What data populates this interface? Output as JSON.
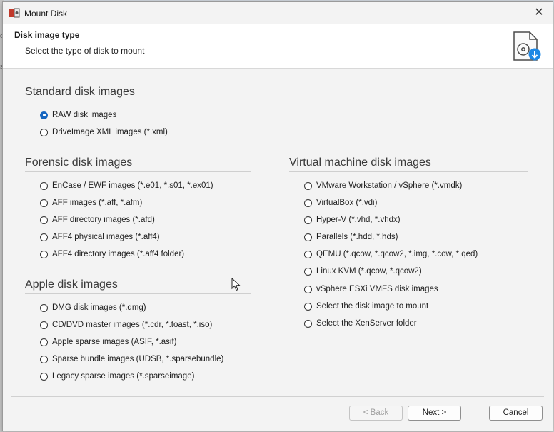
{
  "window": {
    "title": "Mount Disk",
    "close_symbol": "✕"
  },
  "header": {
    "title": "Disk image type",
    "subtitle": "Select the type of disk to mount"
  },
  "sections": {
    "standard": {
      "title": "Standard disk images",
      "options": [
        "RAW disk images",
        "DriveImage XML images (*.xml)"
      ],
      "selected_index": 0
    },
    "forensic": {
      "title": "Forensic disk images",
      "options": [
        "EnCase / EWF images (*.e01, *.s01, *.ex01)",
        "AFF images (*.aff, *.afm)",
        "AFF directory images (*.afd)",
        "AFF4 physical images (*.aff4)",
        "AFF4 directory images (*.aff4 folder)"
      ]
    },
    "apple": {
      "title": "Apple disk images",
      "options": [
        "DMG disk images (*.dmg)",
        "CD/DVD master images (*.cdr, *.toast, *.iso)",
        "Apple sparse images (ASIF, *.asif)",
        "Sparse bundle images (UDSB, *.sparsebundle)",
        "Legacy sparse images (*.sparseimage)"
      ]
    },
    "virtual": {
      "title": "Virtual machine disk images",
      "options": [
        "VMware Workstation / vSphere (*.vmdk)",
        "VirtualBox (*.vdi)",
        "Hyper-V (*.vhd, *.vhdx)",
        "Parallels (*.hdd, *.hds)",
        "QEMU (*.qcow, *.qcow2, *.img, *.cow, *.qed)",
        "Linux KVM (*.qcow, *.qcow2)",
        "vSphere ESXi VMFS disk images",
        "Select the disk image to mount",
        "Select the XenServer folder"
      ]
    }
  },
  "buttons": {
    "back": "< Back",
    "next": "Next >",
    "cancel": "Cancel"
  },
  "background": {
    "mark1": "o",
    "mark2": "s"
  },
  "colors": {
    "accent": "#1565c0",
    "header_bg": "#ffffff",
    "dialog_bg": "#f3f3f3"
  }
}
